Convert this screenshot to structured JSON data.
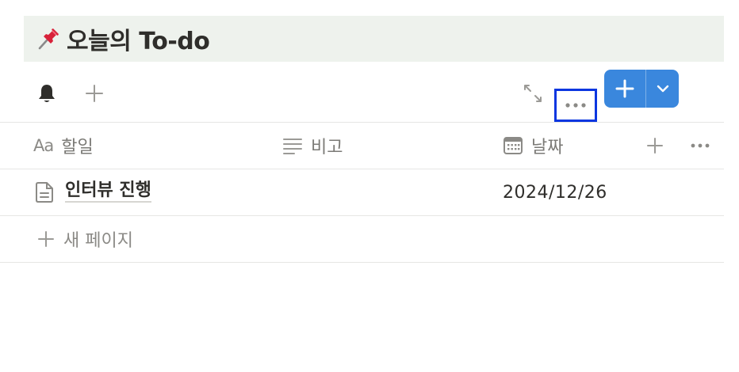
{
  "page": {
    "title_emoji": "📌",
    "title": "오늘의 To-do"
  },
  "toolbar": {
    "bell_icon": "bell-icon",
    "add_view_icon": "plus-icon",
    "expand_icon": "expand-icon",
    "more_icon": "more-horizontal-icon",
    "new_button_icon": "plus-icon",
    "new_dropdown_icon": "chevron-down-icon",
    "accent_color": "#3a87dd",
    "highlight_color": "#0b36e0"
  },
  "table": {
    "columns": [
      {
        "icon": "Aa",
        "label": "할일"
      },
      {
        "icon": "text-lines-icon",
        "label": "비고"
      },
      {
        "icon": "calendar-icon",
        "label": "날짜"
      }
    ],
    "rows": [
      {
        "icon": "document-icon",
        "task": "인터뷰 진행",
        "note": "",
        "date": "2024/12/26"
      }
    ],
    "new_page_label": "새 페이지"
  }
}
